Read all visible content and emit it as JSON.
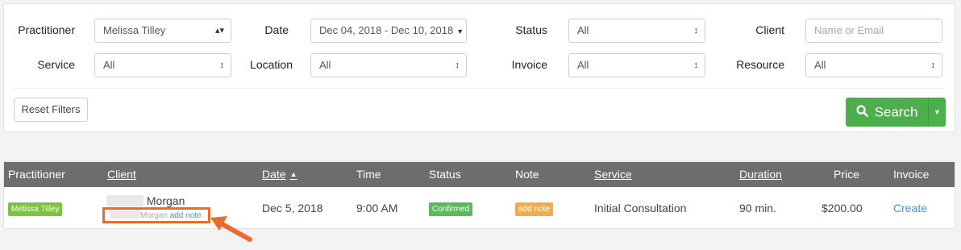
{
  "filters": {
    "practitioner": {
      "label": "Practitioner",
      "value": "Melissa Tilley"
    },
    "date": {
      "label": "Date",
      "value": "Dec 04, 2018 - Dec 10, 2018"
    },
    "status": {
      "label": "Status",
      "value": "All"
    },
    "client": {
      "label": "Client",
      "placeholder": "Name or Email"
    },
    "service": {
      "label": "Service",
      "value": "All"
    },
    "location": {
      "label": "Location",
      "value": "All"
    },
    "invoice": {
      "label": "Invoice",
      "value": "All"
    },
    "resource": {
      "label": "Resource",
      "value": "All"
    },
    "reset_label": "Reset Filters",
    "search_label": "Search"
  },
  "table": {
    "headers": {
      "practitioner": "Practitioner",
      "client": "Client",
      "date": "Date",
      "time": "Time",
      "status": "Status",
      "note": "Note",
      "service": "Service",
      "duration": "Duration",
      "price": "Price",
      "invoice": "Invoice"
    },
    "rows": [
      {
        "practitioner": "Melissa Tilley",
        "client_name": "Morgan",
        "client_note_name": "Morgan",
        "client_add_note": "add note",
        "date": "Dec 5, 2018",
        "time": "9:00 AM",
        "status": "Confirmed",
        "note": "add note",
        "service": "Initial Consultation",
        "duration": "90 min.",
        "price": "$200.00",
        "invoice": "Create"
      }
    ]
  },
  "colors": {
    "accent_green": "#4cae4c",
    "badge_green": "#7dc242",
    "badge_orange": "#f0ad4e",
    "header_gray": "#6d6d6d",
    "link_blue": "#4a90d9",
    "highlight_orange": "#e96b2d"
  }
}
